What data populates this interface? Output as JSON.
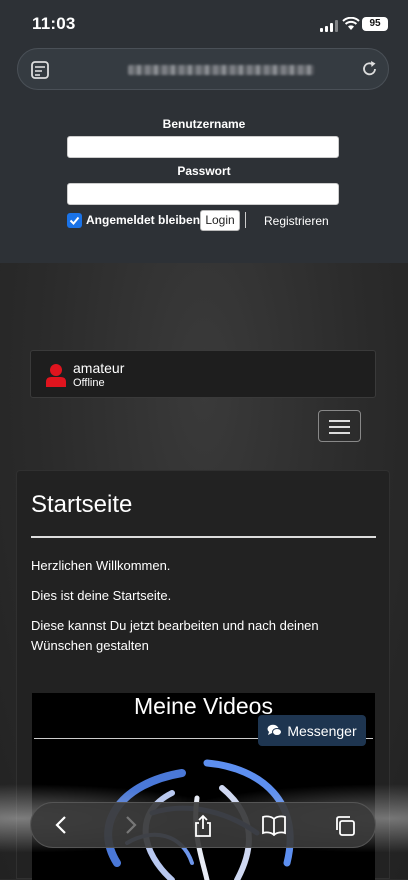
{
  "status_bar": {
    "time": "11:03",
    "battery": "95"
  },
  "url_bar": {
    "icon": "page-menu-icon",
    "reload_icon": "reload-icon"
  },
  "login": {
    "username_label": "Benutzername",
    "password_label": "Passwort",
    "remember_label": "Angemeldet bleiben",
    "remember_checked": true,
    "login_button": "Login",
    "register_link": "Registrieren"
  },
  "user": {
    "name": "amateur",
    "status": "Offline",
    "icon": "user-icon",
    "icon_color": "#e0141e"
  },
  "content": {
    "title": "Startseite",
    "paragraphs": [
      "Herzlichen Willkommen.",
      "Dies ist deine Startseite.",
      "Diese kannst Du jetzt bearbeiten und nach deinen Wünschen gestalten"
    ],
    "video_title": "Meine Videos"
  },
  "messenger": {
    "label": "Messenger",
    "icon": "chat-icon",
    "color": "#1e3550"
  },
  "toolbar": {
    "icons": [
      "back-icon",
      "forward-icon",
      "share-icon",
      "bookmarks-icon",
      "tabs-icon"
    ]
  }
}
